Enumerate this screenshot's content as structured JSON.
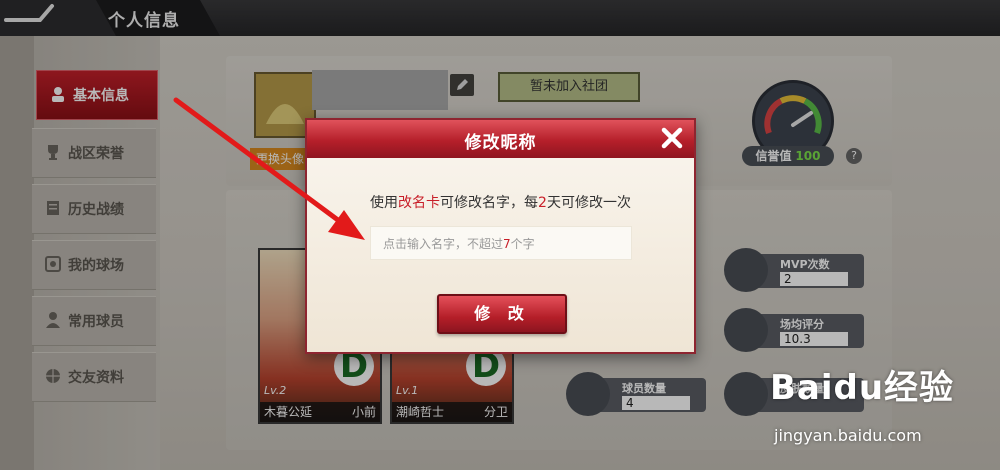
{
  "header": {
    "title": "个人信息"
  },
  "sidebar": {
    "items": [
      {
        "label": "基本信息",
        "icon": "user-icon"
      },
      {
        "label": "战区荣誉",
        "icon": "trophy-icon"
      },
      {
        "label": "历史战绩",
        "icon": "document-icon"
      },
      {
        "label": "我的球场",
        "icon": "court-icon"
      },
      {
        "label": "常用球员",
        "icon": "player-icon"
      },
      {
        "label": "交友资料",
        "icon": "basketball-icon"
      }
    ]
  },
  "profile": {
    "change_avatar_label": "更换头像",
    "club_label": "暂未加入社团",
    "credit_label": "信誉值",
    "credit_value": "100",
    "help_label": "?"
  },
  "cards": [
    {
      "level": "Lv.2",
      "name": "木暮公延",
      "position": "小前",
      "badge": "D"
    },
    {
      "level": "Lv.1",
      "name": "潮崎哲士",
      "position": "分卫",
      "badge": "D"
    }
  ],
  "stats": [
    {
      "title": "MVP次数",
      "value": "2"
    },
    {
      "title": "场均评分",
      "value": "10.3"
    },
    {
      "title": "球员数量",
      "value": "4"
    },
    {
      "title": "皮肤数量",
      "value": ""
    }
  ],
  "dialog": {
    "title": "修改昵称",
    "message_pre": "使用",
    "message_item": "改名卡",
    "message_mid": "可修改名字，每",
    "message_days": "2",
    "message_post": "天可修改一次",
    "input_pre": "点击输入名字，不超过",
    "input_num": "7",
    "input_post": "个字",
    "confirm_label": "修 改"
  },
  "watermark": {
    "brand": "Baidu经验",
    "url": "jingyan.baidu.com"
  },
  "colors": {
    "accent": "#b51f2a",
    "highlight": "#c81e28",
    "gauge": "#3e4550"
  }
}
